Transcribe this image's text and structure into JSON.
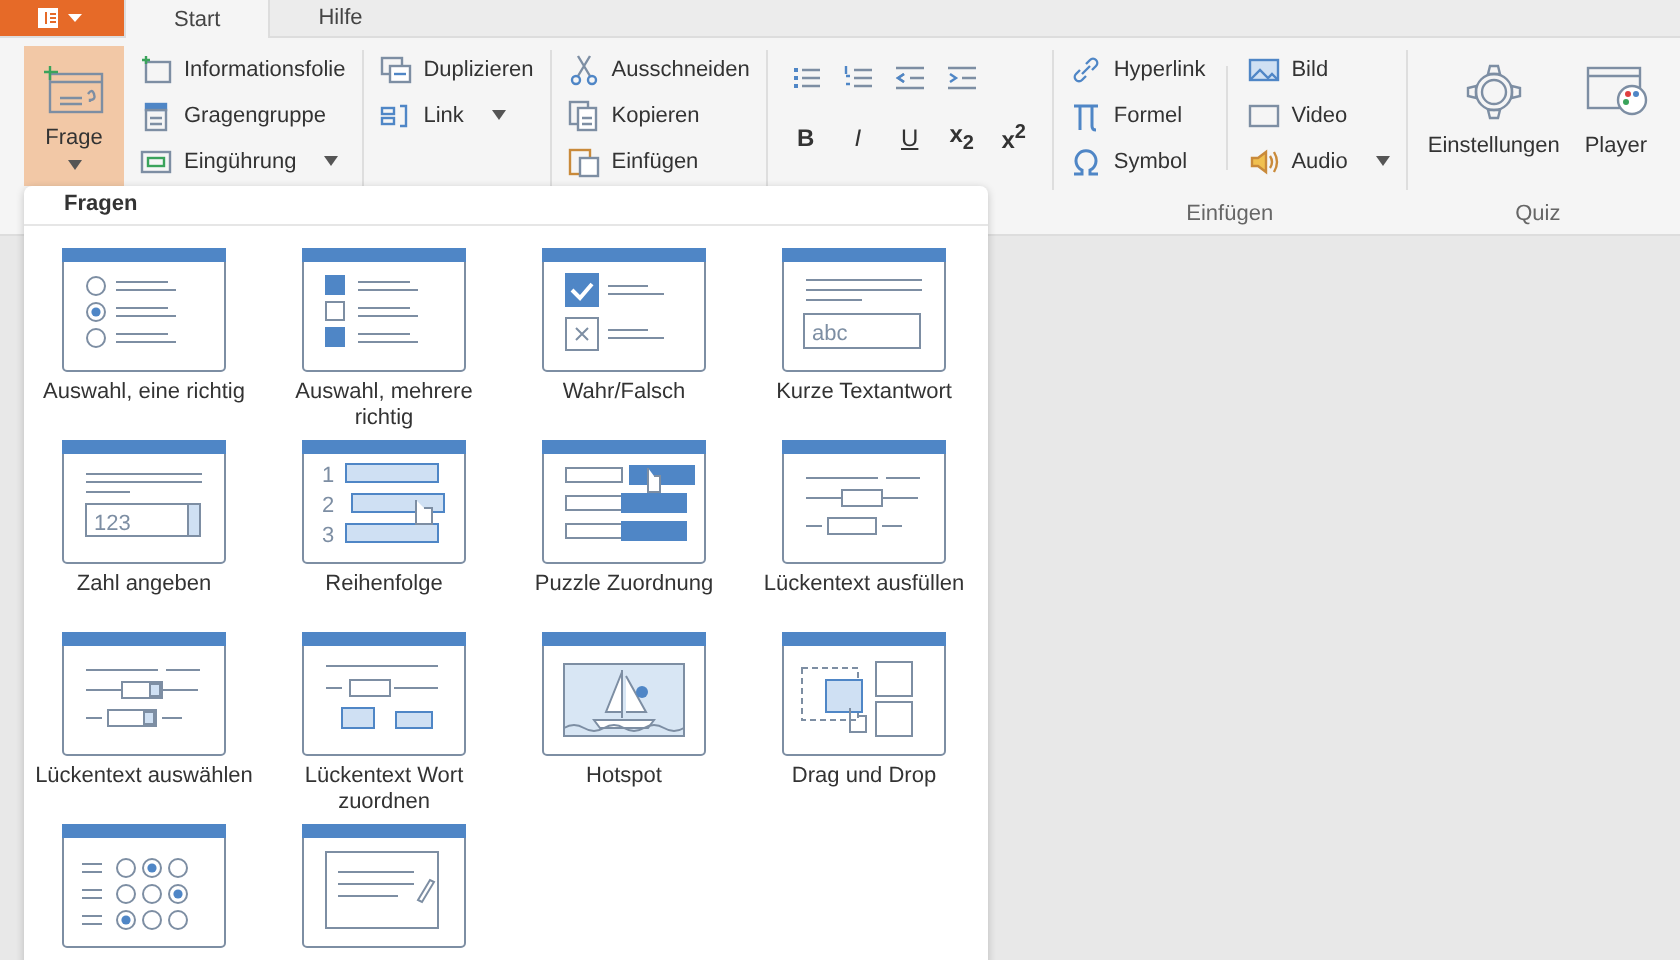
{
  "tabs": [
    {
      "label": "Start",
      "selected": true
    },
    {
      "label": "Hilfe",
      "selected": false
    }
  ],
  "ribbon": {
    "frage": {
      "label": "Frage",
      "expanded": true
    },
    "columns": [
      [
        {
          "label": "Informationsfolie",
          "dropdown": false
        },
        {
          "label": "Gragengruppe",
          "dropdown": false
        },
        {
          "label": "Eingührung",
          "dropdown": true
        }
      ],
      [
        {
          "label": "Duplizieren",
          "dropdown": false
        },
        {
          "label": "Link",
          "dropdown": true
        }
      ],
      [
        {
          "label": "Ausschneiden",
          "dropdown": false
        },
        {
          "label": "Kopieren",
          "dropdown": false
        },
        {
          "label": "Einfügen",
          "dropdown": false
        }
      ]
    ],
    "format_buttons": [
      "B",
      "I",
      "U",
      "x$_{2}$",
      "x$^{2}$"
    ],
    "insert_group": {
      "label": "Einfügen",
      "columns": [
        [
          {
            "label": "Hyperlink",
            "dropdown": false
          },
          {
            "label": "Formel",
            "dropdown": false
          },
          {
            "label": "Symbol",
            "dropdown": false
          }
        ],
        [
          {
            "label": "Bild",
            "dropdown": false
          },
          {
            "label": "Video",
            "dropdown": false
          },
          {
            "label": "Audio",
            "dropdown": true
          }
        ]
      ]
    },
    "quiz_group": {
      "label": "Quiz",
      "buttons": [
        {
          "label": "Einstellungen"
        },
        {
          "label": "Player"
        }
      ]
    }
  },
  "question_panel": {
    "title": "Fragen",
    "items": [
      {
        "label": "Auswahl, eine richtig",
        "kind": "single"
      },
      {
        "label": "Auswahl, mehrere richtig",
        "kind": "multi"
      },
      {
        "label": "Wahr/Falsch",
        "kind": "truefalse"
      },
      {
        "label": "Kurze Textantwort",
        "kind": "shorttext",
        "sample": "abc"
      },
      {
        "label": "Zahl angeben",
        "kind": "number",
        "sample": "123"
      },
      {
        "label": "Reihenfolge",
        "kind": "sequence",
        "numbers": [
          "1",
          "2",
          "3"
        ]
      },
      {
        "label": "Puzzle Zuordnung",
        "kind": "puzzle"
      },
      {
        "label": "Lückentext ausfüllen",
        "kind": "fillgap"
      },
      {
        "label": "Lückentext auswählen",
        "kind": "gapselect"
      },
      {
        "label": "Lückentext Wort zuordnen",
        "kind": "gapword"
      },
      {
        "label": "Hotspot",
        "kind": "hotspot"
      },
      {
        "label": "Drag und Drop",
        "kind": "dragdrop"
      },
      {
        "kind": "matrix"
      },
      {
        "kind": "essay"
      }
    ]
  }
}
